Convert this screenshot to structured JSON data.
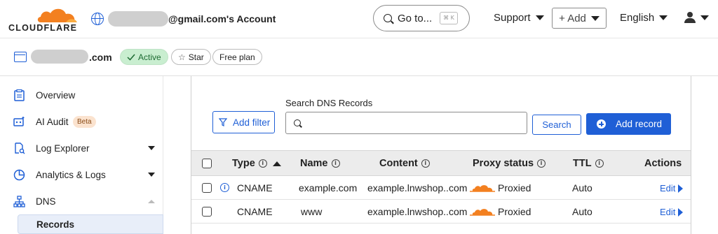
{
  "header": {
    "logo_text": "CLOUDFLARE",
    "account_suffix": "@gmail.com's Account",
    "goto_label": "Go to...",
    "goto_shortcut": "⌘ K",
    "support_label": "Support",
    "add_label": "+ Add",
    "language_label": "English"
  },
  "zone": {
    "name_suffix": ".com",
    "status": "Active",
    "star_label": "Star",
    "plan": "Free plan"
  },
  "sidebar": {
    "items": [
      {
        "label": "Overview",
        "icon": "clipboard-icon"
      },
      {
        "label": "AI Audit",
        "icon": "robot-icon",
        "badge": "Beta"
      },
      {
        "label": "Log Explorer",
        "icon": "document-search-icon"
      },
      {
        "label": "Analytics & Logs",
        "icon": "chart-icon"
      },
      {
        "label": "DNS",
        "icon": "network-icon"
      }
    ],
    "sub_item": "Records"
  },
  "dns": {
    "add_filter_label": "Add filter",
    "search_label": "Search DNS Records",
    "search_value": "",
    "search_button": "Search",
    "add_record_label": "Add record",
    "columns": {
      "type": "Type",
      "name": "Name",
      "content": "Content",
      "proxy": "Proxy status",
      "ttl": "TTL",
      "actions": "Actions"
    },
    "rows": [
      {
        "type": "CNAME",
        "name": "example.com",
        "content": "example.lnwshop..com",
        "proxy": "Proxied",
        "ttl": "Auto",
        "action": "Edit"
      },
      {
        "type": "CNAME",
        "name": "www",
        "content": "example.lnwshop..com",
        "proxy": "Proxied",
        "ttl": "Auto",
        "action": "Edit"
      }
    ]
  },
  "colors": {
    "accent": "#1f5fd6",
    "cloud_orange": "#f38020",
    "active_green": "#c9eed0"
  }
}
